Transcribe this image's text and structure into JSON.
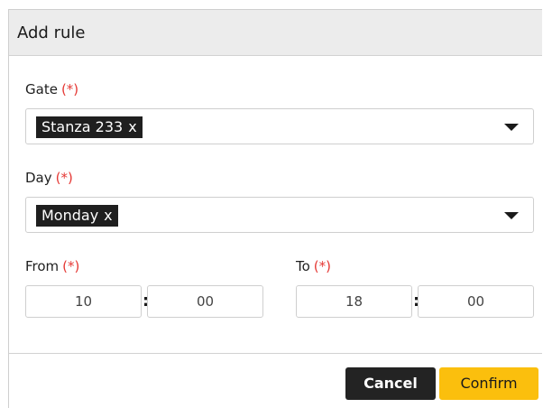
{
  "dialog": {
    "title": "Add rule",
    "required_marker": "(*)"
  },
  "gate": {
    "label": "Gate",
    "selected": "Stanza 233",
    "remove_glyph": "x"
  },
  "day": {
    "label": "Day",
    "selected": "Monday",
    "remove_glyph": "x"
  },
  "from": {
    "label": "From",
    "hours": "10",
    "minutes": "00",
    "separator": ":"
  },
  "to": {
    "label": "To",
    "hours": "18",
    "minutes": "00",
    "separator": ":"
  },
  "buttons": {
    "cancel": "Cancel",
    "confirm": "Confirm"
  },
  "colors": {
    "required": "#e53935",
    "confirm": "#fbbf0d",
    "cancel": "#232323"
  },
  "icons": {
    "dropdown": "chevron-down-icon"
  }
}
